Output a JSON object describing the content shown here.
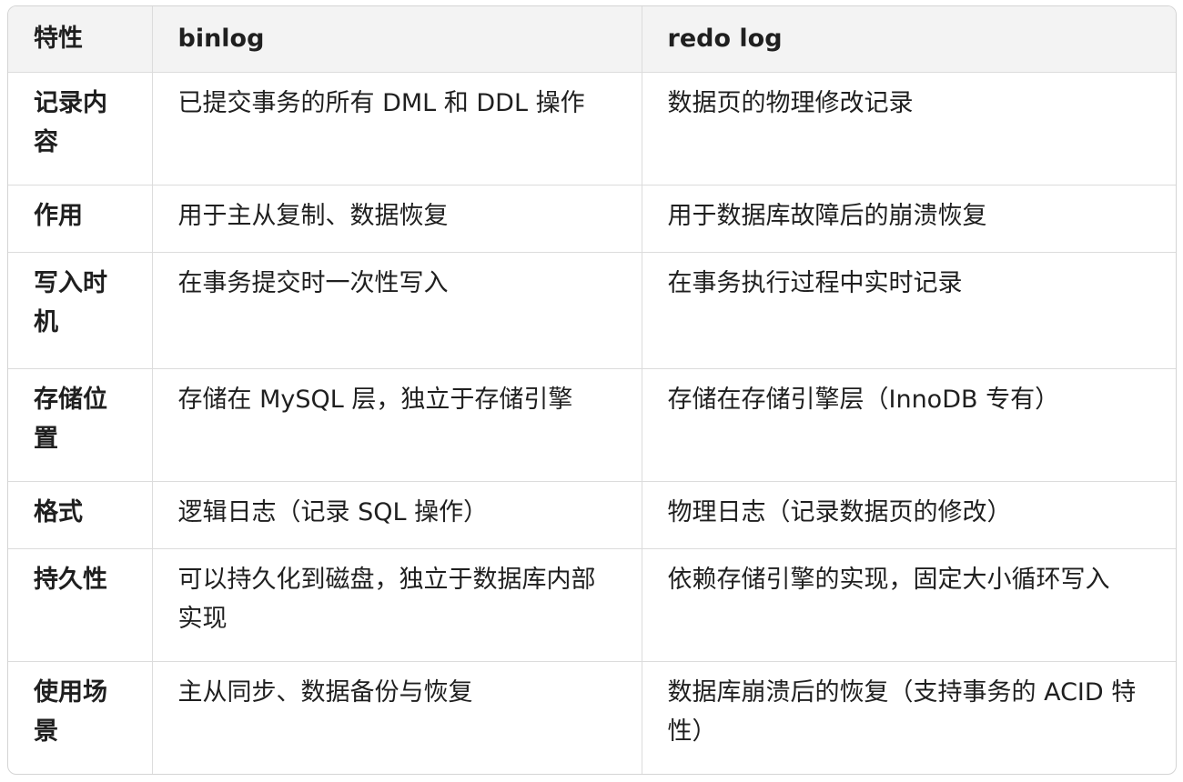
{
  "table": {
    "headers": [
      "特性",
      "binlog",
      "redo log"
    ],
    "rows": [
      {
        "feature": "记录内容",
        "binlog": "已提交事务的所有 DML 和 DDL 操作",
        "redo": "数据页的物理修改记录"
      },
      {
        "feature": "作用",
        "binlog": "用于主从复制、数据恢复",
        "redo": "用于数据库故障后的崩溃恢复"
      },
      {
        "feature": "写入时机",
        "binlog": "在事务提交时一次性写入",
        "redo": "在事务执行过程中实时记录"
      },
      {
        "feature": "存储位置",
        "binlog": "存储在 MySQL 层，独立于存储引擎",
        "redo": "存储在存储引擎层（InnoDB 专有）"
      },
      {
        "feature": "格式",
        "binlog": "逻辑日志（记录 SQL 操作）",
        "redo": "物理日志（记录数据页的修改）"
      },
      {
        "feature": "持久性",
        "binlog": "可以持久化到磁盘，独立于数据库内部实现",
        "redo": "依赖存储引擎的实现，固定大小循环写入"
      },
      {
        "feature": "使用场景",
        "binlog": "主从同步、数据备份与恢复",
        "redo": "数据库崩溃后的恢复（支持事务的 ACID 特性）"
      }
    ]
  }
}
